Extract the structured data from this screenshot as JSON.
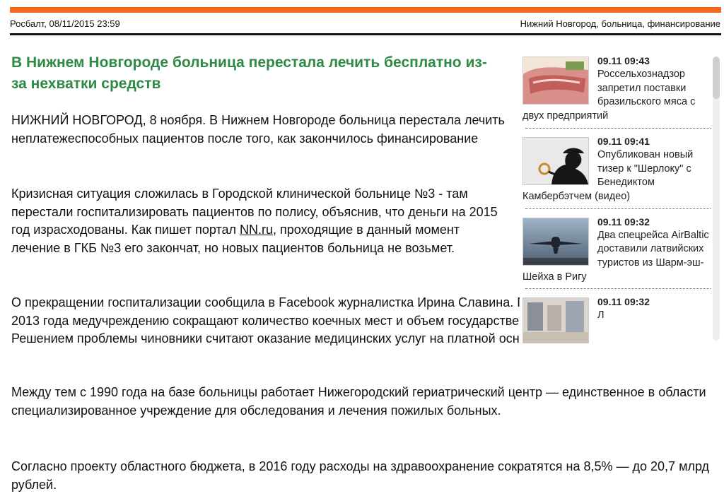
{
  "header": {
    "source": "Росбалт, 08/11/2015 23:59",
    "tags": "Нижний Новгород, больница, финансирование",
    "accent_color": "#f26a1b"
  },
  "article": {
    "title": "В Нижнем Новгороде больница перестала лечить бесплатно из-за нехватки средств",
    "title_color": "#2e8a45",
    "lead": "НИЖНИЙ НОВГОРОД, 8 ноября. В Нижнем Новгороде больница перестала лечить неплатежеспособных пациентов после того, как закончилось финансирование",
    "p2_before": "Кризисная ситуация сложилась в Городской клинической больнице №3  - там перестали госпитализировать пациентов по полису, объяснив, что деньги на 2015 год израсходованы. Как пишет портал ",
    "p2_link": "NN.ru",
    "p2_after": ", проходящие в данный момент лечение в ГКБ №3 его закончат, но новых пациентов больница не возьмет.",
    "p3": "О прекращении госпитализации сообщила в Facebook журналистка Ирина Славина. По словам врачей, с 2013 года медучреждению сокращают количество коечных мест и объем государственного заказа. Решением проблемы чиновники считают оказание медицинских услуг на платной основе.",
    "p4": "Между тем с 1990 года на базе больницы работает Нижегородский гериатрический центр — единственное в области специализированное учреждение для обследования и лечения пожилых больных.",
    "p5": "Согласно проекту областного бюджета, в 2016 году расходы на здравоохранение сократятся на 8,5% — до 20,7 млрд рублей."
  },
  "sidebar": {
    "items": [
      {
        "time": "09.11 09:43",
        "text": "Россельхознадзор запретил поставки бразильского мяса с двух предприятий",
        "thumb": "meat-photo"
      },
      {
        "time": "09.11 09:41",
        "text": "Опубликован новый тизер к \"Шерлоку\" с Бенедиктом Камбербэтчем (видео)",
        "thumb": "sherlock-silhouette"
      },
      {
        "time": "09.11 09:32",
        "text": "Два спецрейса AirBaltic доставили латвийских туристов из Шарм-эш-Шейха в Ригу",
        "thumb": "airplane-photo"
      },
      {
        "time": "09.11 09:32",
        "text": "Л",
        "thumb": "interior-photo"
      }
    ]
  }
}
